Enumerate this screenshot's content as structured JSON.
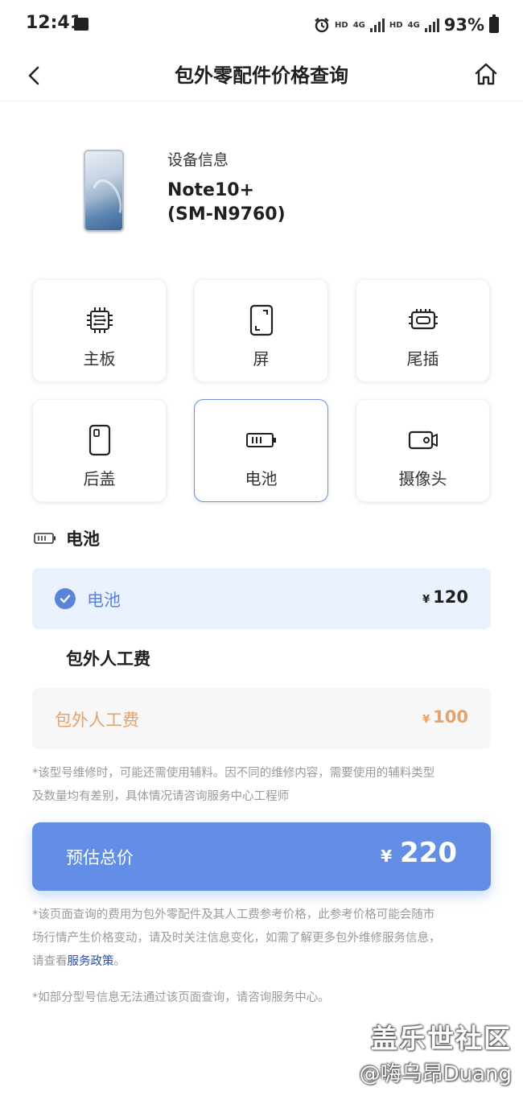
{
  "status_bar": {
    "time": "12:41",
    "network_1": "HD",
    "network_2": "4G",
    "network_3": "HD",
    "network_4": "4G",
    "battery": "93%"
  },
  "header": {
    "title": "包外零配件价格查询",
    "back_icon": "chevron-left-icon",
    "home_icon": "home-icon"
  },
  "device": {
    "label": "设备信息",
    "model_line1": "Note10+",
    "model_line2": "(SM-N9760)"
  },
  "parts": [
    {
      "label": "主板",
      "icon": "chip-icon"
    },
    {
      "label": "屏",
      "icon": "screen-icon"
    },
    {
      "label": "尾插",
      "icon": "port-icon"
    },
    {
      "label": "后盖",
      "icon": "back-cover-icon"
    },
    {
      "label": "电池",
      "icon": "battery-icon"
    },
    {
      "label": "摄像头",
      "icon": "camera-icon"
    }
  ],
  "selected_part": "电池",
  "battery_section": {
    "title": "电池",
    "option_name": "电池",
    "currency": "¥",
    "price": "120"
  },
  "labor_section": {
    "title": "包外人工费",
    "option_name": "包外人工费",
    "currency": "¥",
    "price": "100"
  },
  "note_1": {
    "line1": "*该型号维修时，可能还需使用辅料。因不同的维修内容，需要使用的辅料类型",
    "line2": "及数量均有差别，具体情况请咨询服务中心工程师"
  },
  "total": {
    "label": "预估总价",
    "currency": "¥",
    "value": "220"
  },
  "note_2": {
    "line1": "*该页面查询的费用为包外零配件及其人工费参考价格，此参考价格可能会随市",
    "line2": "场行情产生价格变动，请及时关注信息变化，如需了解更多包外维修服务信息，",
    "line3_prefix": "请查看",
    "link": "服务政策",
    "line3_suffix": "。"
  },
  "note_3": "*如部分型号信息无法通过该页面查询，请咨询服务中心。",
  "watermark": {
    "line1": "盖乐世社区",
    "line2": "@嗨乌昂Duang"
  },
  "colors": {
    "accent": "#628ee6",
    "selected_bg": "#eaf2fd",
    "selected_text": "#5b83da",
    "labor_text": "#e3a36a",
    "link": "#2b4fa6"
  }
}
